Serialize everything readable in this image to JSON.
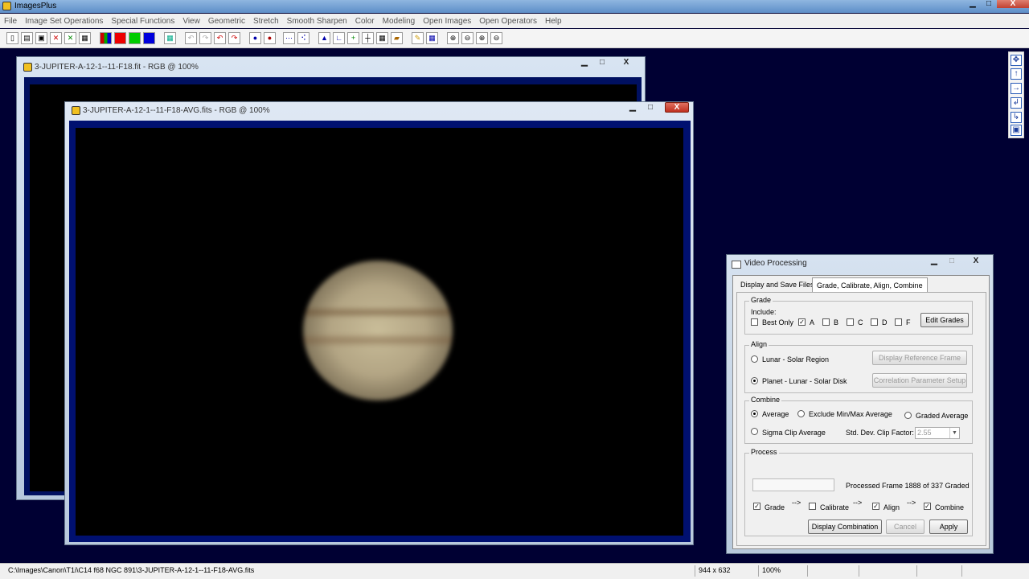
{
  "app": {
    "title": "ImagesPlus",
    "min_label": "▁",
    "max_label": "□",
    "close_label": "X"
  },
  "menu": [
    "File",
    "Image Set Operations",
    "Special Functions",
    "View",
    "Geometric",
    "Stretch",
    "Smooth Sharpen",
    "Color",
    "Modeling",
    "Open Images",
    "Open Operators",
    "Help"
  ],
  "windows": {
    "back": {
      "title": "3-JUPITER-A-12-1--11-F18.fit - RGB @ 100%"
    },
    "front": {
      "title": "3-JUPITER-A-12-1--11-F18-AVG.fits - RGB @ 100%"
    },
    "ctrl_min": "▁",
    "ctrl_max": "□",
    "ctrl_close": "X"
  },
  "dialog": {
    "title": "Video Processing",
    "tabs": [
      "Display and Save Files",
      "Grade, Calibrate, Align, Combine"
    ],
    "grade": {
      "label": "Grade",
      "include": "Include:",
      "options": [
        {
          "label": "Best Only",
          "checked": false
        },
        {
          "label": "A",
          "checked": true
        },
        {
          "label": "B",
          "checked": false
        },
        {
          "label": "C",
          "checked": false
        },
        {
          "label": "D",
          "checked": false
        },
        {
          "label": "F",
          "checked": false
        }
      ],
      "edit_button": "Edit Grades"
    },
    "align": {
      "label": "Align",
      "lunar_solar_region": "Lunar - Solar Region",
      "planet_lunar_solar_disk": "Planet - Lunar - Solar Disk",
      "display_reference_frame": "Display Reference Frame",
      "correlation_setup": "Correlation Parameter Setup"
    },
    "combine": {
      "label": "Combine",
      "average": "Average",
      "exclude_minmax": "Exclude Min/Max Average",
      "graded_average": "Graded Average",
      "sigma_clip": "Sigma Clip Average",
      "std_dev_label": "Std. Dev. Clip Factor:",
      "std_dev_value": "2.55",
      "select_arrow": "▼"
    },
    "process": {
      "label": "Process",
      "status": "Processed Frame 1888 of 337 Graded",
      "steps": [
        {
          "label": "Grade",
          "checked": true
        },
        {
          "label": "Calibrate",
          "checked": false
        },
        {
          "label": "Align",
          "checked": true
        },
        {
          "label": "Combine",
          "checked": true
        }
      ],
      "arrow": "-->",
      "display_combination": "Display Combination",
      "cancel": "Cancel",
      "apply": "Apply"
    }
  },
  "statusbar": {
    "path": "C:\\Images\\Canon\\T1i\\C14 f68 NGC 891\\3-JUPITER-A-12-1--11-F18-AVG.fits",
    "dimensions": "944 x 632",
    "zoom": "100%"
  },
  "check_glyph": "✓",
  "toolbar_glyphs": [
    "▯",
    "▤",
    "▣",
    "✕",
    "✕",
    "▦",
    "",
    "",
    "",
    "",
    "▦",
    "↶",
    "↷",
    "↶",
    "↷",
    "●",
    "●",
    "⋯",
    "⠪",
    "▲",
    "∟",
    "+",
    "┼",
    "▦",
    "▰",
    "✎",
    "▦",
    "⊕",
    "⊖",
    "⊕",
    "⊖"
  ],
  "rtoolbar_glyphs": [
    "✥",
    "↑",
    "→",
    "↲",
    "↳",
    "▣"
  ],
  "colors": {
    "desktop": "#000033",
    "image_frame": "#001070",
    "accent_red": "#c03020"
  }
}
